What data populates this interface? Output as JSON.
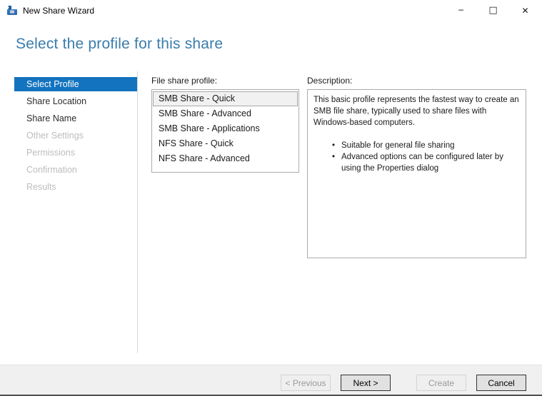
{
  "window": {
    "title": "New Share Wizard"
  },
  "icons": {
    "minimize": "─",
    "maximize": "□",
    "close": "✕",
    "bullet": "•"
  },
  "page": {
    "heading": "Select the profile for this share"
  },
  "sidebar": {
    "items": [
      {
        "label": "Select Profile",
        "state": "active"
      },
      {
        "label": "Share Location",
        "state": "enabled"
      },
      {
        "label": "Share Name",
        "state": "enabled"
      },
      {
        "label": "Other Settings",
        "state": "disabled"
      },
      {
        "label": "Permissions",
        "state": "disabled"
      },
      {
        "label": "Confirmation",
        "state": "disabled"
      },
      {
        "label": "Results",
        "state": "disabled"
      }
    ]
  },
  "profile_list": {
    "label": "File share profile:",
    "selected_index": 0,
    "items": [
      "SMB Share - Quick",
      "SMB Share - Advanced",
      "SMB Share - Applications",
      "NFS Share - Quick",
      "NFS Share - Advanced"
    ]
  },
  "description": {
    "label": "Description:",
    "text": "This basic profile represents the fastest way to create an SMB file share, typically used to share files with Windows-based computers.",
    "bullets": [
      "Suitable for general file sharing",
      "Advanced options can be configured later by using the Properties dialog"
    ]
  },
  "footer": {
    "buttons": [
      {
        "label": "< Previous",
        "state": "disabled"
      },
      {
        "label": "Next >",
        "state": "enabled"
      },
      {
        "label": "Create",
        "state": "disabled"
      },
      {
        "label": "Cancel",
        "state": "enabled"
      }
    ]
  },
  "colors": {
    "accent_blue": "#1373bf",
    "heading_blue": "#3a7cab",
    "box_border": "#ababab",
    "footer_bg": "#f0f0f0",
    "disabled_text": "#bdbdbd"
  }
}
